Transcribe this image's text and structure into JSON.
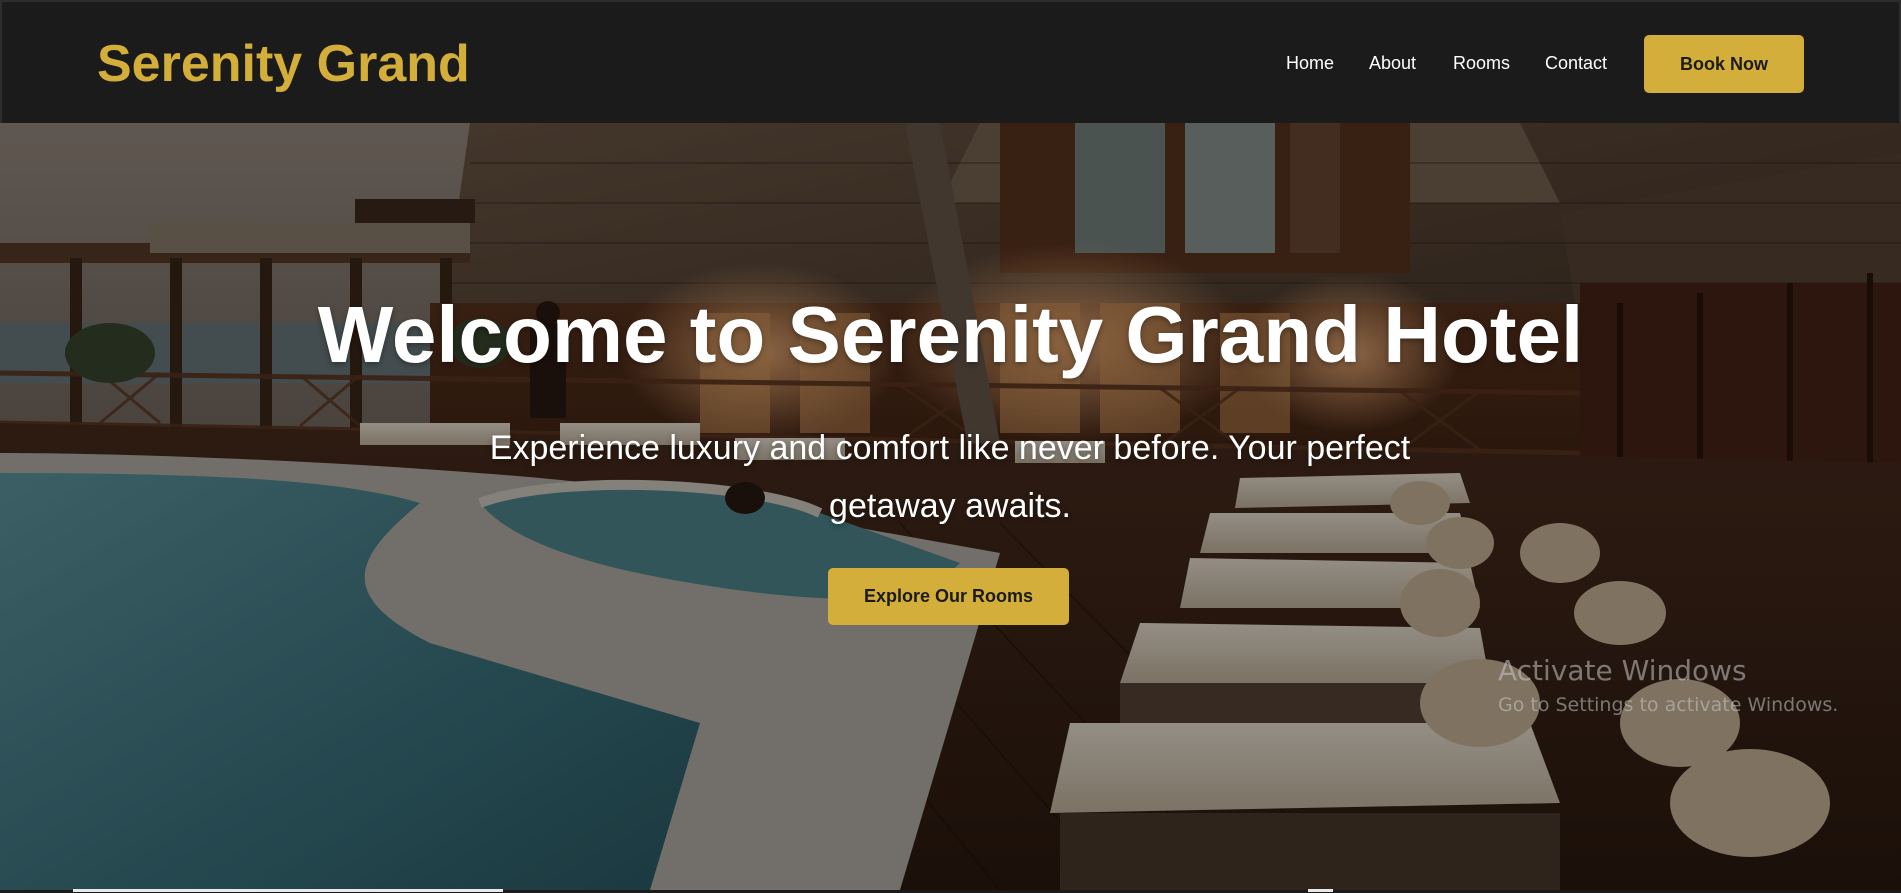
{
  "brand": {
    "name": "Serenity Grand",
    "color": "#d4ae3a"
  },
  "nav": {
    "links": [
      "Home",
      "About",
      "Rooms",
      "Contact"
    ],
    "cta_label": "Book Now"
  },
  "hero": {
    "title": "Welcome to Serenity Grand Hotel",
    "subtitle": "Experience luxury and comfort like never before. Your perfect getaway awaits.",
    "cta_label": "Explore Our Rooms"
  },
  "overlay_text": {
    "title": "Activate Windows",
    "subtitle": "Go to Settings to activate Windows."
  },
  "colors": {
    "accent": "#d4ae3a",
    "navbar_bg": "#1b1b1b",
    "text_light": "#ffffff"
  }
}
